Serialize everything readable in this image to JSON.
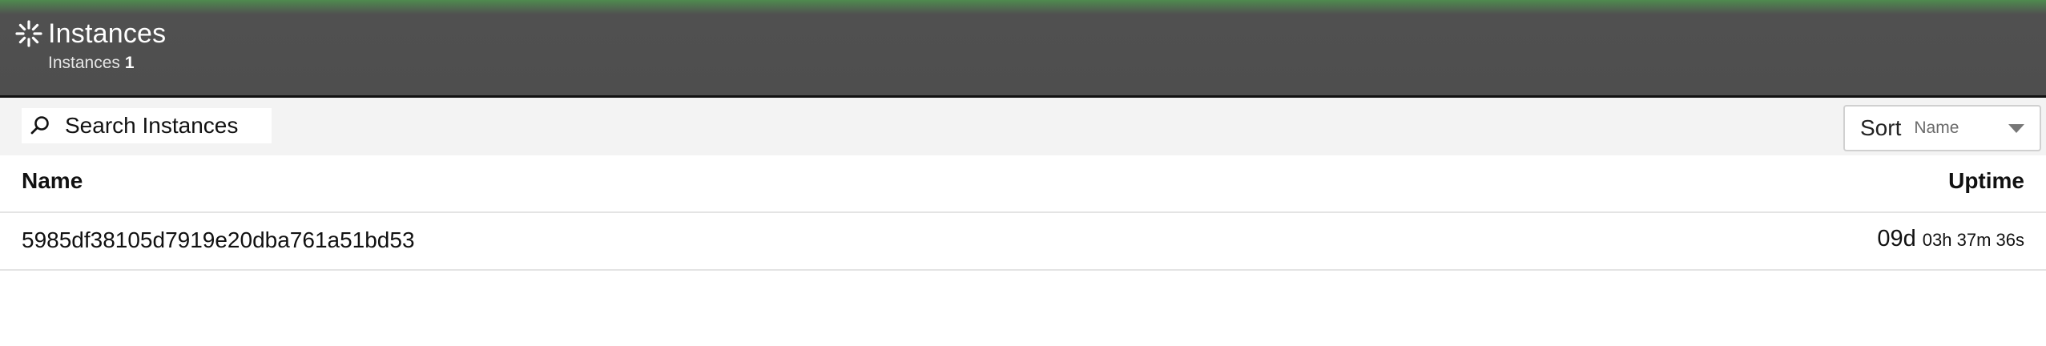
{
  "header": {
    "title": "Instances",
    "subtitle_label": "Instances",
    "subtitle_count": "1",
    "icon": "spinner-icon",
    "gradient_top_color": "#4f8a4f",
    "background_color": "#4e4e4e"
  },
  "toolbar": {
    "search": {
      "icon": "search-icon",
      "placeholder": "Search Instances",
      "value": ""
    },
    "sort": {
      "label": "Sort",
      "selected": "Name",
      "icon": "chevron-down-icon"
    }
  },
  "table": {
    "columns": [
      "Name",
      "Uptime"
    ],
    "rows": [
      {
        "name": "5985df38105d7919e20dba761a51bd53",
        "uptime_days": "09d",
        "uptime_rest": "03h 37m 36s"
      }
    ]
  }
}
